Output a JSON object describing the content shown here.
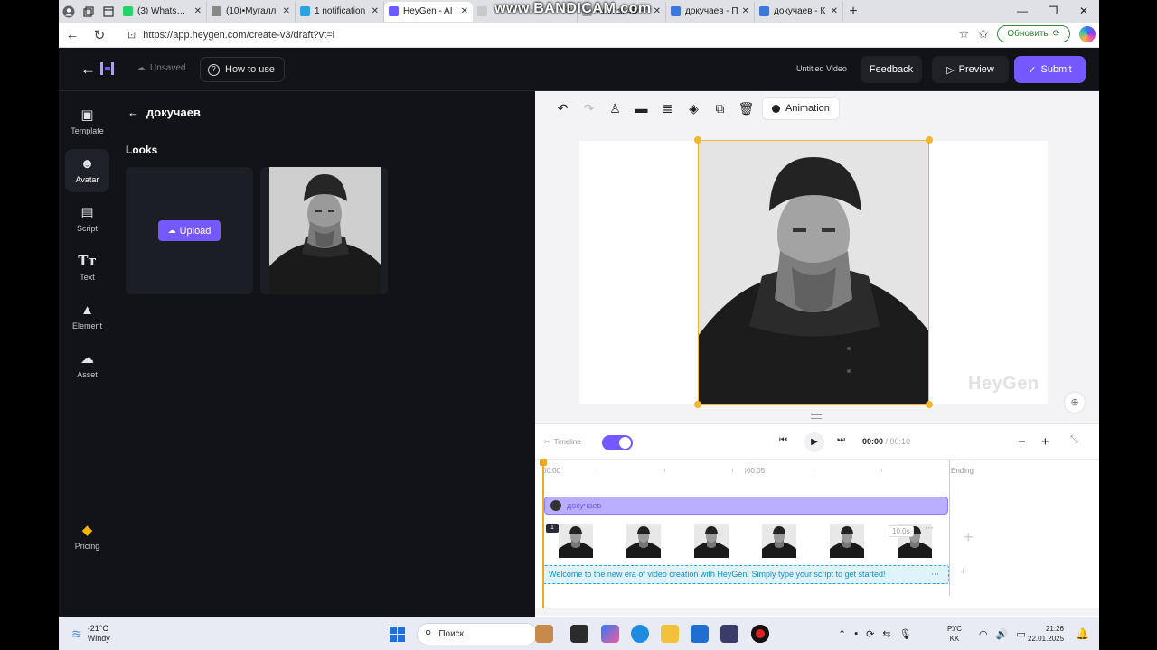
{
  "browser": {
    "tabs": [
      {
        "title": "(3) WhatsApp",
        "color": "#25d366",
        "active": false
      },
      {
        "title": "(10)•Мугаллі",
        "color": "#888888",
        "active": false
      },
      {
        "title": "1 notification",
        "color": "#2aa3e0",
        "active": false
      },
      {
        "title": "HeyGen - AI",
        "color": "#6b5cff",
        "active": true
      },
      {
        "title": "Animal 4D+",
        "color": "#9aa0a6",
        "active": false
      },
      {
        "title": "докучаев - П",
        "color": "#3c78d8",
        "active": false
      },
      {
        "title": "докучаев - К",
        "color": "#3c78d8",
        "active": false
      }
    ],
    "url": "https://app.heygen.com/create-v3/draft?vt=l",
    "update_label": "Обновить",
    "recorder_watermark": "www.BANDICAM.com"
  },
  "header": {
    "unsaved_label": "Unsaved",
    "how_to_use_label": "How to use",
    "video_title": "Untitled Video",
    "feedback_label": "Feedback",
    "preview_label": "Preview",
    "submit_label": "Submit"
  },
  "sidebar": {
    "items": [
      {
        "label": "Template",
        "icon": "template-icon"
      },
      {
        "label": "Avatar",
        "icon": "avatar-icon",
        "active": true
      },
      {
        "label": "Script",
        "icon": "script-icon"
      },
      {
        "label": "Text",
        "icon": "text-icon"
      },
      {
        "label": "Element",
        "icon": "element-icon"
      },
      {
        "label": "Asset",
        "icon": "asset-icon"
      }
    ],
    "pricing_label": "Pricing"
  },
  "panel": {
    "title": "докучаев",
    "looks_label": "Looks",
    "upload_label": "Upload"
  },
  "canvas": {
    "animation_label": "Animation",
    "watermark": "HeyGen"
  },
  "timeline": {
    "label": "Timeline",
    "current_time": "00:00",
    "total_time": "/ 00:10",
    "ruler": [
      "00:00",
      "00:05",
      "Ending"
    ],
    "avatar_track_label": "докучаев",
    "scene_number": "1",
    "scene_duration": "10.0s",
    "script_text": "Welcome to the new era of video creation with HeyGen! Simply type your script to get started!"
  },
  "taskbar": {
    "temperature": "-21°C",
    "weather": "Windy",
    "search_label": "Поиск",
    "lang_top": "РУС",
    "lang_bottom": "KK",
    "time": "21:26",
    "date": "22.01.2025"
  },
  "colors": {
    "accent": "#7559ff",
    "selection": "#f2b632",
    "script_track": "#2aa8e0"
  }
}
